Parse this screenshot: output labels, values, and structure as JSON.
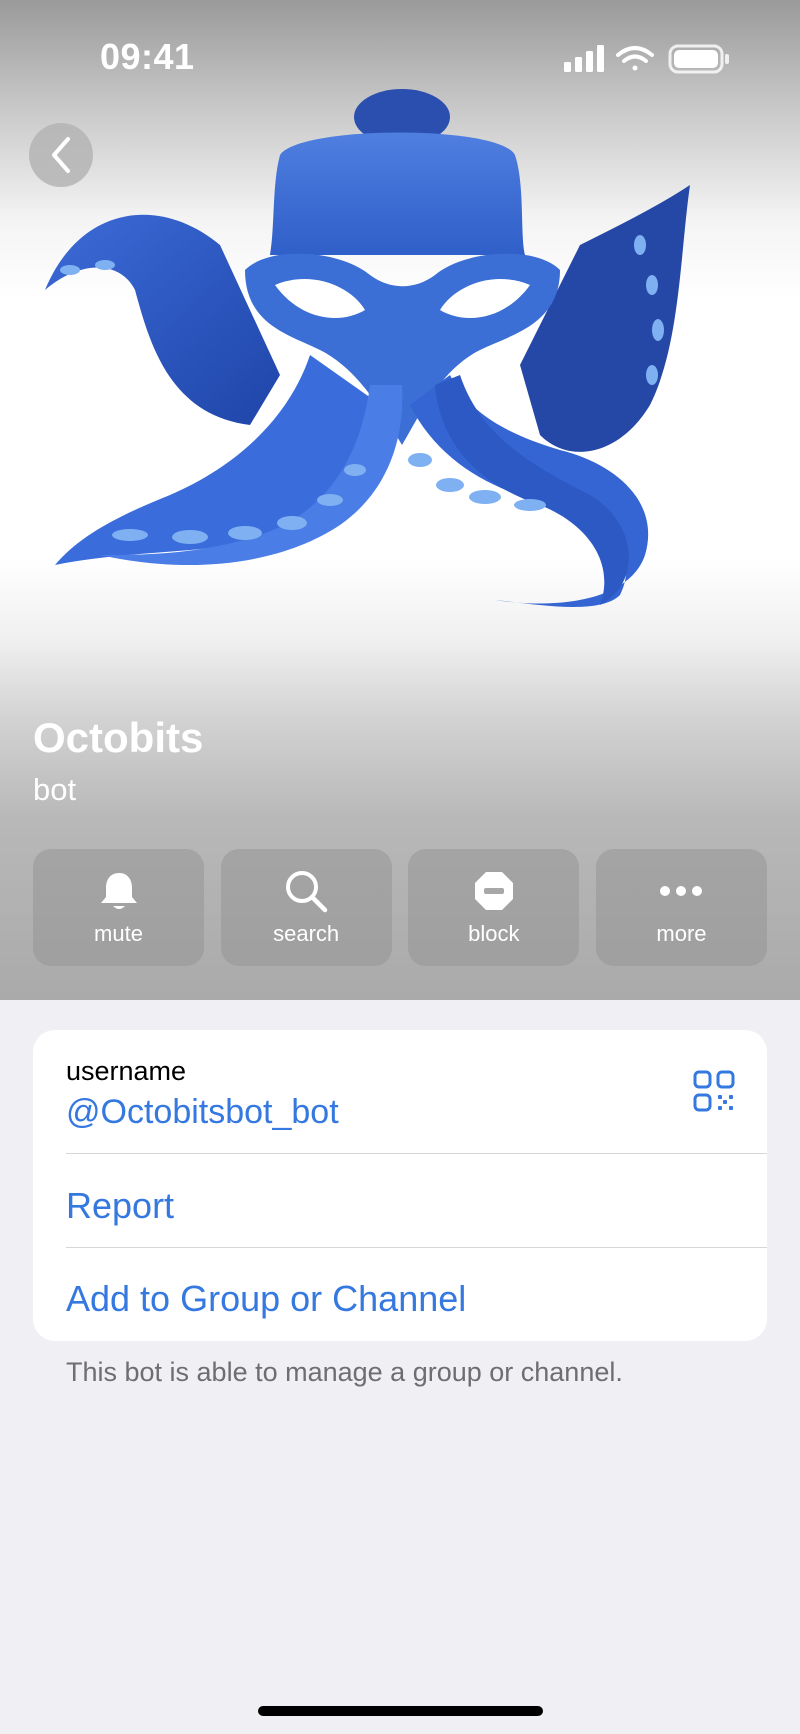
{
  "status_bar": {
    "time": "09:41",
    "icons": [
      "cellular-signal-icon",
      "wifi-icon",
      "battery-icon"
    ]
  },
  "navigation": {
    "back_icon": "chevron-left-icon"
  },
  "profile": {
    "name": "Octobits",
    "subtitle": "bot",
    "avatar": "octopus-illustration"
  },
  "actions": [
    {
      "label": "mute",
      "icon": "bell-icon"
    },
    {
      "label": "search",
      "icon": "magnifier-icon"
    },
    {
      "label": "block",
      "icon": "block-icon"
    },
    {
      "label": "more",
      "icon": "ellipsis-icon"
    }
  ],
  "info": {
    "username_label": "username",
    "username_value": "@Octobitsbot_bot",
    "qr_icon": "qr-code-icon",
    "report_label": "Report",
    "add_label": "Add to Group or Channel",
    "footnote": "This bot is able to manage a group or channel."
  },
  "colors": {
    "accent": "#3478e0",
    "octopus_blue": "#3b6fd6",
    "background": "#efeff4"
  }
}
